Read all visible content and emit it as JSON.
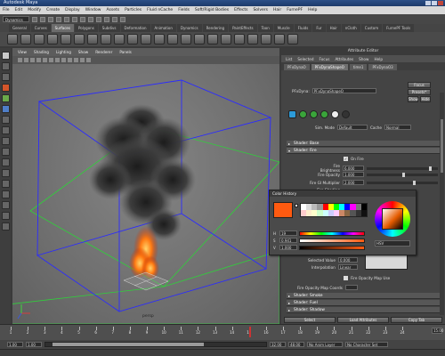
{
  "window": {
    "title": "Autodesk Maya"
  },
  "menubar": [
    "File",
    "Edit",
    "Modify",
    "Create",
    "Display",
    "Window",
    "Assets",
    "Particles",
    "Fluid nCache",
    "Fields",
    "Soft/Rigid Bodies",
    "Effects",
    "Solvers",
    "Hair",
    "FurnePF",
    "Help"
  ],
  "statusline": {
    "mode": "Dynamics"
  },
  "shelf_tabs": [
    "General",
    "Curves",
    "Surfaces",
    "Polygons",
    "Subdivs",
    "Deformation",
    "Animation",
    "Dynamics",
    "Rendering",
    "PaintEffects",
    "Toon",
    "Muscle",
    "Fluids",
    "Fur",
    "Hair",
    "nCloth",
    "Custom",
    "FurnePF Tools"
  ],
  "shelf_active": "Surfaces",
  "viewport": {
    "menu": [
      "View",
      "Shading",
      "Lighting",
      "Show",
      "Renderer",
      "Panels"
    ],
    "camera_label": "persp"
  },
  "attr_editor": {
    "title": "Attribute Editor",
    "menu": [
      "List",
      "Selected",
      "Focus",
      "Attributes",
      "Show",
      "Help"
    ],
    "tabs": [
      "PFxDynaO",
      "PFxDynaShapeO",
      "time1",
      "PFxDynaO3"
    ],
    "active_tab": "PFxDynaShapeO",
    "node_label": "PFxDyna:",
    "node_value": "PFxDynaShapeO",
    "focus_btn": "Focus",
    "presets_btn": "Presets*",
    "show_btn": "Show",
    "hide_btn": "Hide",
    "sim_mode_label": "Sim. Mode",
    "sim_mode_value": "Default",
    "cache_label": "Cache",
    "cache_value": "Normal",
    "sections": {
      "shader_base": "Shader: Base",
      "shader_fire": "Shader: Fire",
      "shader_smoke": "Shader: Smoke",
      "shader_fuel": "Shader: Fuel",
      "shader_shadow": "Shader: Shadow"
    },
    "on_fire_label": "On Fire",
    "fire_brightness_label": "Fire Brightness",
    "fire_brightness_value": "6.000",
    "fire_opacity_label": "Fire Opacity",
    "fire_opacity_value": "1.000",
    "fire_gi_label": "Fire GI Multiplier",
    "fire_gi_value": "2.000",
    "fire_shading_label": "Fire Shading",
    "selected_value_label": "Selected Value",
    "selected_value": "0.000",
    "interpolation_label": "Interpolation",
    "interpolation_value": "Linear",
    "fire_opacity_map_label": "Fire Opacity Map Use",
    "fire_opacity_map_coords": "Fire Opacity Map Coords",
    "bottom_buttons": [
      "Select",
      "Load Attributes",
      "Copy Tab"
    ]
  },
  "color_picker": {
    "title": "Color History",
    "current_color": "#ff5a10",
    "fields": [
      {
        "label": "H",
        "value": "19"
      },
      {
        "label": "S",
        "value": "0.941"
      },
      {
        "label": "V",
        "value": "1.000"
      }
    ],
    "mode": "HSV",
    "palette": [
      "#ffffff",
      "#dddddd",
      "#bbbbbb",
      "#999999",
      "#ff0000",
      "#ffff00",
      "#00ff00",
      "#00ffff",
      "#0000ff",
      "#ff00ff",
      "#777777",
      "#000000",
      "#ffcccc",
      "#ffeecc",
      "#ffffcc",
      "#ccffcc",
      "#ccffff",
      "#ccccff",
      "#ffccff",
      "#cc8866",
      "#886644",
      "#555555",
      "#333333",
      "#111111"
    ]
  },
  "timeline": {
    "ticks": [
      "1",
      "2",
      "3",
      "4",
      "5",
      "6",
      "7",
      "8",
      "9",
      "10",
      "11",
      "12",
      "13",
      "14",
      "15",
      "16",
      "17",
      "18",
      "19",
      "20",
      "21",
      "22",
      "23",
      "24"
    ],
    "current_frame": "15.00"
  },
  "range": {
    "start": "1.00",
    "start2": "1.00",
    "end": "32.00",
    "end2": "48.00",
    "anim_layer": "No Anim Layer",
    "char_set": "No Character Set"
  },
  "colors": {
    "accent": "#5a7fc0",
    "wire": "#2c2cff",
    "grid": "#29d12f"
  }
}
